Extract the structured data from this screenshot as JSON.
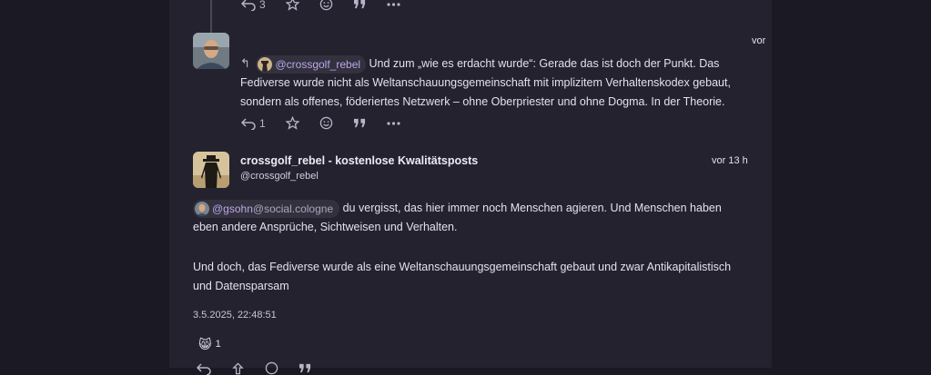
{
  "top_post": {
    "reply_count": "3"
  },
  "reply_post": {
    "time": "vor",
    "mention": "@crossgolf_rebel",
    "text_line1": "Und zum „wie es erdacht wurde“: Gerade das ist doch der Punkt. Das",
    "text_line2": "Fediverse wurde nicht als Weltanschauungsgemeinschaft mit implizitem Verhaltenskodex gebaut,",
    "text_line3": "sondern als offenes, föderiertes Netzwerk – ohne Oberpriester und ohne Dogma. In der Theorie.",
    "reply_count": "1"
  },
  "main_post": {
    "author_name": "crossgolf_rebel - kostenlose Kwalitätsposts",
    "author_handle": "@crossgolf_rebel",
    "time": "vor 13 h",
    "mention_user": "@gsohn",
    "mention_host": "@social.cologne",
    "para1_line1": "du vergisst, das hier immer noch Menschen agieren. Und Menschen haben",
    "para1_line2": "eben andere Ansprüche,  Sichtweisen und Verhalten.",
    "para2_line1": "Und doch, das Fediverse wurde als eine Weltanschauungsgemeinschaft gebaut und zwar Antikapitalistisch",
    "para2_line2": "und Datensparsam",
    "timestamp": "3.5.2025, 22:48:51",
    "reaction_emoji": "😸",
    "reaction_count": "1"
  },
  "icons": [
    "reply-icon",
    "favourite-icon",
    "emoji-react-icon",
    "quote-icon",
    "more-icon"
  ]
}
